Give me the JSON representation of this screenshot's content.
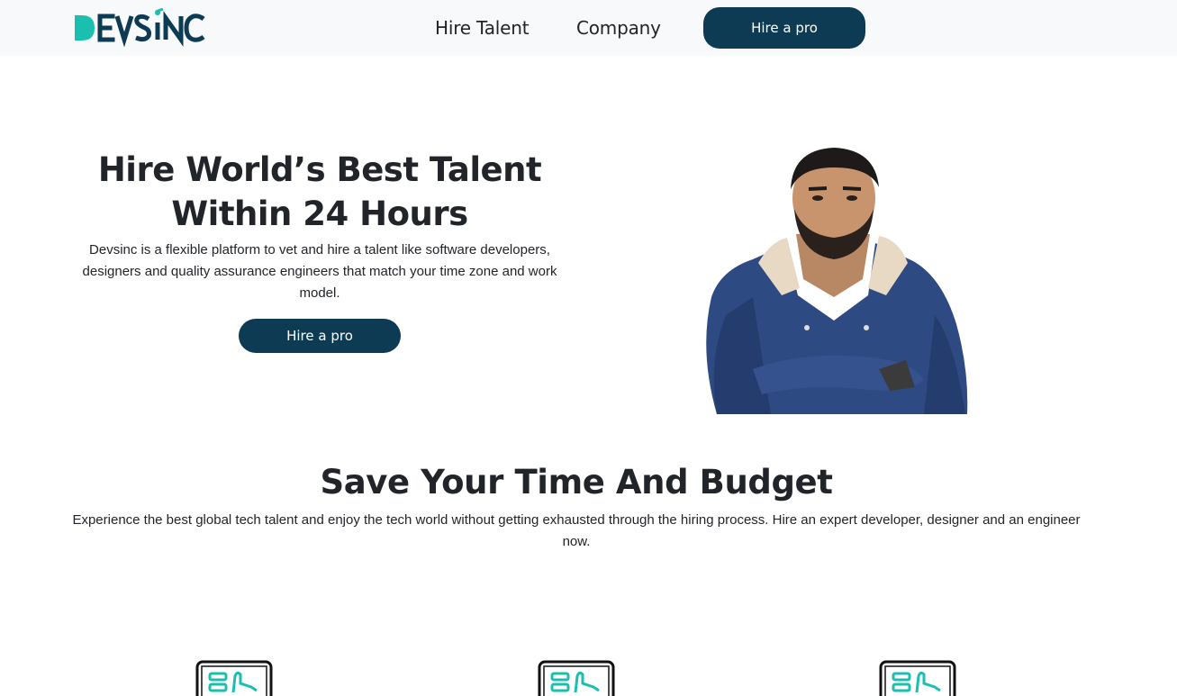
{
  "header": {
    "logo_text": "DEVSiNC",
    "nav": [
      {
        "label": "Hire Talent"
      },
      {
        "label": "Company"
      }
    ],
    "cta_label": "Hire a pro"
  },
  "hero": {
    "title_line1": "Hire World’s Best Talent",
    "title_line2": "Within 24 Hours",
    "description": "Devsinc is a flexible platform to vet and hire a talent like software developers, designers and quality assurance engineers that match your time zone and work model.",
    "cta_label": "Hire a pro"
  },
  "section": {
    "title": "Save Your Time And Budget",
    "description": "Experience the best global tech talent and enjoy the tech world without getting exhausted through the hiring process. Hire an expert developer, designer and an engineer now."
  },
  "colors": {
    "brand_navy": "#0e3b54",
    "brand_teal": "#1bbfb0",
    "header_bg": "#f8f9fa"
  },
  "features": [
    {
      "icon": "tablet-ui-icon"
    },
    {
      "icon": "tablet-ui-icon"
    },
    {
      "icon": "tablet-ui-icon"
    }
  ]
}
